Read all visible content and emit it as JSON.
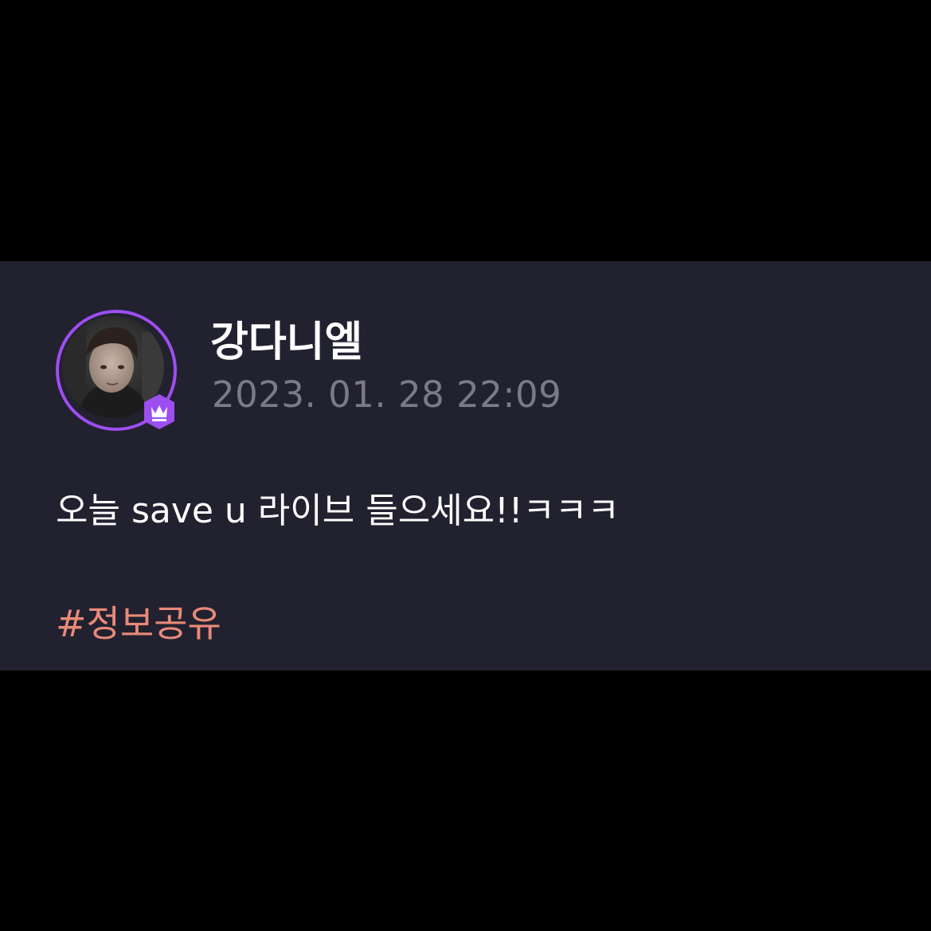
{
  "post": {
    "author": {
      "name": "강다니엘",
      "avatar_icon": "user-avatar-photo",
      "badge_icon": "crown-icon",
      "ring_color": "#9d4ef0"
    },
    "timestamp": "2023. 01. 28 22:09",
    "text": "오늘 save u 라이브 들으세요!!ㅋㅋㅋ",
    "hashtag": "#정보공유",
    "colors": {
      "background": "#22212f",
      "hashtag": "#e88a78",
      "timestamp": "#7b7a8a"
    }
  }
}
